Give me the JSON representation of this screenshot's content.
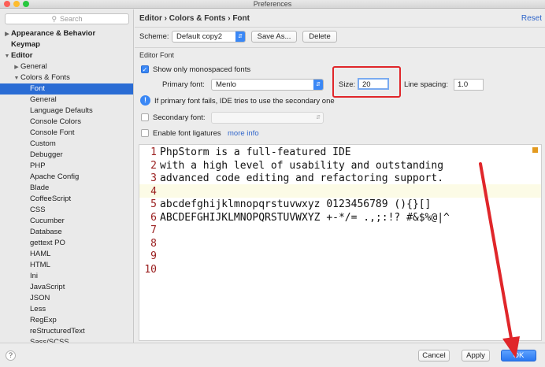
{
  "window": {
    "title": "Preferences"
  },
  "sidebar": {
    "search_placeholder": "Search",
    "items": [
      {
        "label": "Appearance & Behavior",
        "bold": true,
        "arrow": "▶",
        "indent": 0
      },
      {
        "label": "Keymap",
        "bold": true,
        "arrow": "",
        "indent": 0
      },
      {
        "label": "Editor",
        "bold": true,
        "arrow": "▼",
        "indent": 0
      },
      {
        "label": "General",
        "bold": false,
        "arrow": "▶",
        "indent": 1
      },
      {
        "label": "Colors & Fonts",
        "bold": false,
        "arrow": "▼",
        "indent": 1
      },
      {
        "label": "Font",
        "bold": false,
        "arrow": "",
        "indent": 2,
        "selected": true
      },
      {
        "label": "General",
        "bold": false,
        "arrow": "",
        "indent": 2
      },
      {
        "label": "Language Defaults",
        "bold": false,
        "arrow": "",
        "indent": 2
      },
      {
        "label": "Console Colors",
        "bold": false,
        "arrow": "",
        "indent": 2
      },
      {
        "label": "Console Font",
        "bold": false,
        "arrow": "",
        "indent": 2
      },
      {
        "label": "Custom",
        "bold": false,
        "arrow": "",
        "indent": 2
      },
      {
        "label": "Debugger",
        "bold": false,
        "arrow": "",
        "indent": 2
      },
      {
        "label": "PHP",
        "bold": false,
        "arrow": "",
        "indent": 2
      },
      {
        "label": "Apache Config",
        "bold": false,
        "arrow": "",
        "indent": 2
      },
      {
        "label": "Blade",
        "bold": false,
        "arrow": "",
        "indent": 2
      },
      {
        "label": "CoffeeScript",
        "bold": false,
        "arrow": "",
        "indent": 2
      },
      {
        "label": "CSS",
        "bold": false,
        "arrow": "",
        "indent": 2
      },
      {
        "label": "Cucumber",
        "bold": false,
        "arrow": "",
        "indent": 2
      },
      {
        "label": "Database",
        "bold": false,
        "arrow": "",
        "indent": 2
      },
      {
        "label": "gettext PO",
        "bold": false,
        "arrow": "",
        "indent": 2
      },
      {
        "label": "HAML",
        "bold": false,
        "arrow": "",
        "indent": 2
      },
      {
        "label": "HTML",
        "bold": false,
        "arrow": "",
        "indent": 2
      },
      {
        "label": "Ini",
        "bold": false,
        "arrow": "",
        "indent": 2
      },
      {
        "label": "JavaScript",
        "bold": false,
        "arrow": "",
        "indent": 2
      },
      {
        "label": "JSON",
        "bold": false,
        "arrow": "",
        "indent": 2
      },
      {
        "label": "Less",
        "bold": false,
        "arrow": "",
        "indent": 2
      },
      {
        "label": "RegExp",
        "bold": false,
        "arrow": "",
        "indent": 2
      },
      {
        "label": "reStructuredText",
        "bold": false,
        "arrow": "",
        "indent": 2
      },
      {
        "label": "Sass/SCSS",
        "bold": false,
        "arrow": "",
        "indent": 2
      }
    ]
  },
  "main": {
    "breadcrumb": "Editor › Colors & Fonts › Font",
    "reset_label": "Reset",
    "scheme_label": "Scheme:",
    "scheme_value": "Default copy2",
    "save_as_label": "Save As...",
    "delete_label": "Delete",
    "section_title": "Editor Font",
    "monospaced_label": "Show only monospaced fonts",
    "monospaced_checked": true,
    "primary_font_label": "Primary font:",
    "primary_font_value": "Menlo",
    "size_label": "Size:",
    "size_value": "20",
    "line_spacing_label": "Line spacing:",
    "line_spacing_value": "1.0",
    "info_text": "If primary font fails, IDE tries to use the secondary one",
    "secondary_font_label": "Secondary font:",
    "secondary_checked": false,
    "ligatures_label": "Enable font ligatures",
    "ligatures_checked": false,
    "more_info_label": "more info"
  },
  "preview": {
    "lines": [
      "PhpStorm is a full-featured IDE",
      "with a high level of usability and outstanding",
      "advanced code editing and refactoring support.",
      "",
      "abcdefghijklmnopqrstuvwxyz 0123456789 (){}[]",
      "ABCDEFGHIJKLMNOPQRSTUVWXYZ +-*/= .,;:!? #&$%@|^",
      "",
      "",
      "",
      ""
    ],
    "line_numbers": [
      "1",
      "2",
      "3",
      "4",
      "5",
      "6",
      "7",
      "8",
      "9",
      "10"
    ]
  },
  "footer": {
    "help_label": "?",
    "cancel_label": "Cancel",
    "apply_label": "Apply",
    "ok_label": "OK"
  },
  "colors": {
    "accent": "#3a87f5",
    "selection": "#2a6cd4",
    "annotation_red": "#e0262a"
  }
}
